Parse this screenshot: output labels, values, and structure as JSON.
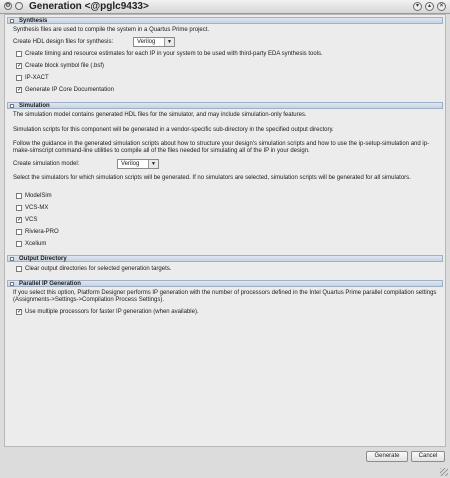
{
  "window": {
    "title": "Generation <@pglc9433>"
  },
  "synthesis": {
    "header": "Synthesis",
    "desc": "Synthesis files are used to compile the system in a Quartus Prime project.",
    "hdl_label": "Create HDL design files for synthesis:",
    "hdl_value": "Verilog",
    "options": [
      {
        "label": "Create timing and resource estimates for each IP in your system to be used with third-party EDA synthesis tools.",
        "checked": false
      },
      {
        "label": "Create block symbol file (.bsf)",
        "checked": true
      },
      {
        "label": "IP-XACT",
        "checked": false
      },
      {
        "label": "Generate IP Core Documentation",
        "checked": true
      }
    ]
  },
  "simulation": {
    "header": "Simulation",
    "desc1": "The simulation model contains generated HDL files for the simulator, and may include simulation-only features.",
    "desc2": "Simulation scripts for this component will be generated in a vendor-specific sub-directory in the specified output directory.",
    "desc3": "Follow the guidance in the generated simulation scripts about how to structure your design's simulation scripts and how to use the ip-setup-simulation and ip-make-simscript command-line utilities to compile all of the files needed for simulating all of the IP in your design.",
    "model_label": "Create simulation model:",
    "model_value": "Verilog",
    "select_desc": "Select the simulators for which simulation scripts will be generated. If no simulators are selected, simulation scripts will be generated for all simulators.",
    "simulators": [
      {
        "label": "ModelSim",
        "checked": false
      },
      {
        "label": "VCS-MX",
        "checked": false
      },
      {
        "label": "VCS",
        "checked": true
      },
      {
        "label": "Riviera-PRO",
        "checked": false
      },
      {
        "label": "Xcelium",
        "checked": false
      }
    ]
  },
  "output": {
    "header": "Output Directory",
    "clear_label": "Clear output directories for selected generation targets.",
    "clear_checked": false
  },
  "parallel": {
    "header": "Parallel IP Generation",
    "desc": "If you select this option, Platform Designer performs IP generation with the number of processors defined in the Intel Quartus Prime parallel compilation settings (Assignments->Settings->Compilation Process Settings).",
    "multi_label": "Use multiple processors for faster IP generation (when available).",
    "multi_checked": true
  },
  "footer": {
    "generate_label": "Generate",
    "cancel_label": "Cancel"
  },
  "icons": {
    "title_icons": [
      "gear-icon",
      "circle-icon"
    ],
    "window_controls": [
      "chevron-down-icon",
      "chevron-up-icon",
      "close-icon"
    ]
  }
}
